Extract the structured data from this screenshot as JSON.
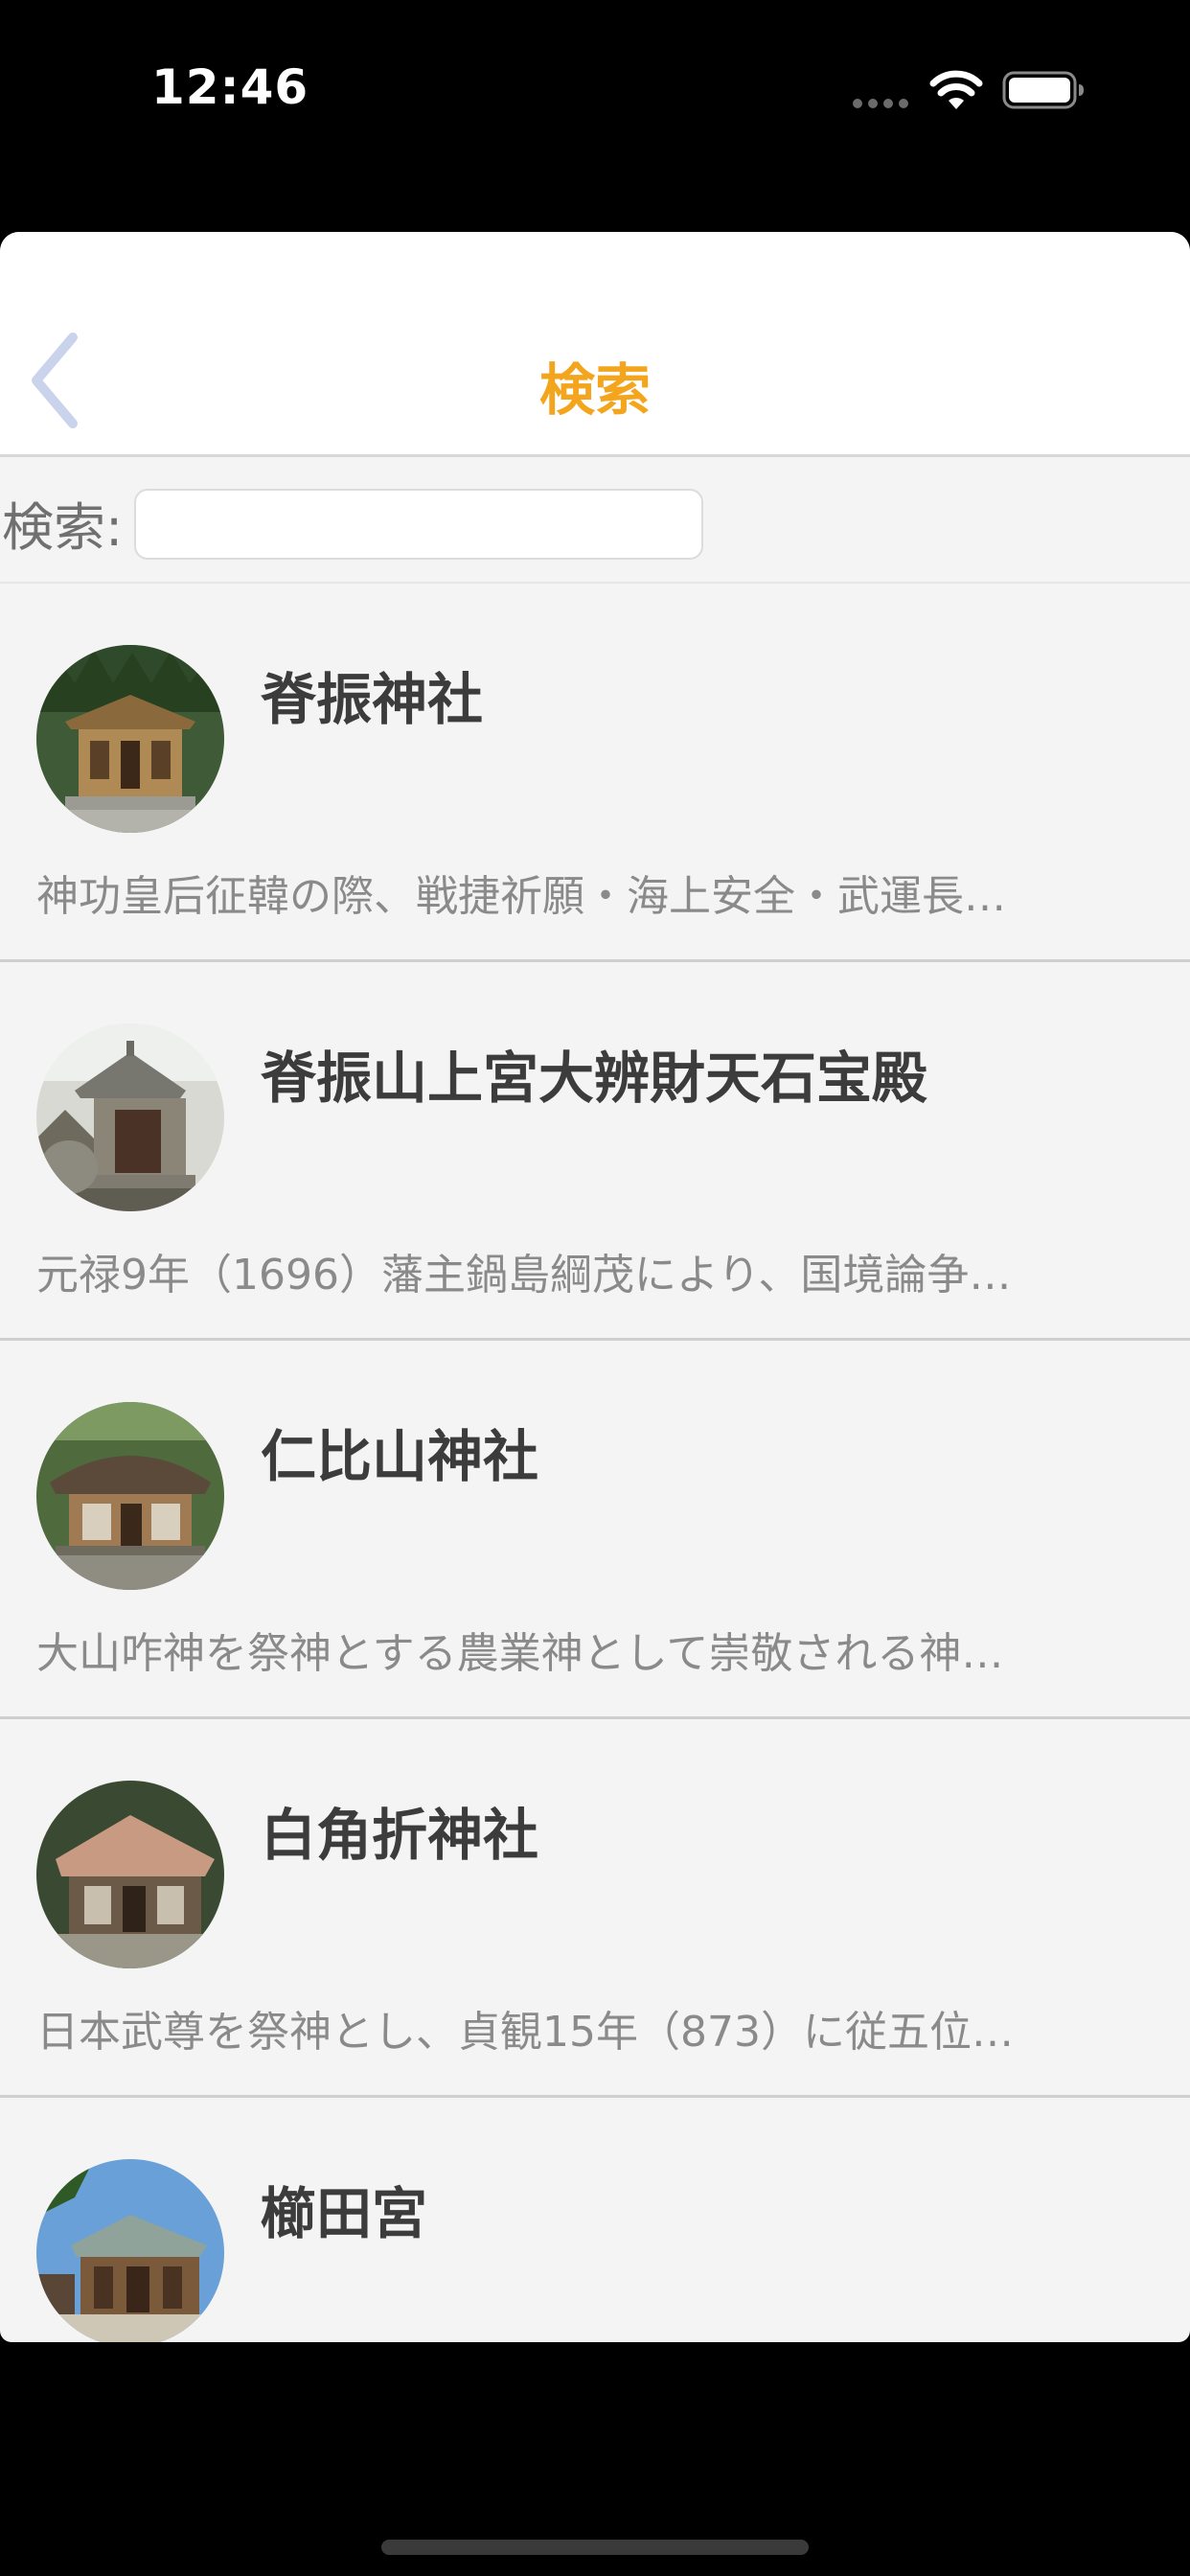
{
  "status_bar": {
    "time": "12:46",
    "icons": [
      "cellular-signal-icon",
      "wifi-icon",
      "battery-icon"
    ]
  },
  "nav": {
    "title": "検索",
    "back_icon": "chevron-left-icon",
    "title_color": "#f2a51d",
    "back_color": "#c9d3ec"
  },
  "search": {
    "label": "検索:",
    "value": "",
    "placeholder": ""
  },
  "list": {
    "items": [
      {
        "title": "脊振神社",
        "description": "神功皇后征韓の際、戦捷祈願・海上安全・武運長…",
        "image": "shrine-photo"
      },
      {
        "title": "脊振山上宮大辨財天石宝殿",
        "description": "元禄9年（1696）藩主鍋島綱茂により、国境論争…",
        "image": "stone-shrine-photo"
      },
      {
        "title": "仁比山神社",
        "description": "大山咋神を祭神とする農業神として崇敬される神…",
        "image": "shrine-photo"
      },
      {
        "title": "白角折神社",
        "description": "日本武尊を祭神とし、貞観15年（873）に従五位…",
        "image": "shrine-photo"
      },
      {
        "title": "櫛田宮",
        "description": "",
        "image": "shrine-photo"
      }
    ]
  }
}
